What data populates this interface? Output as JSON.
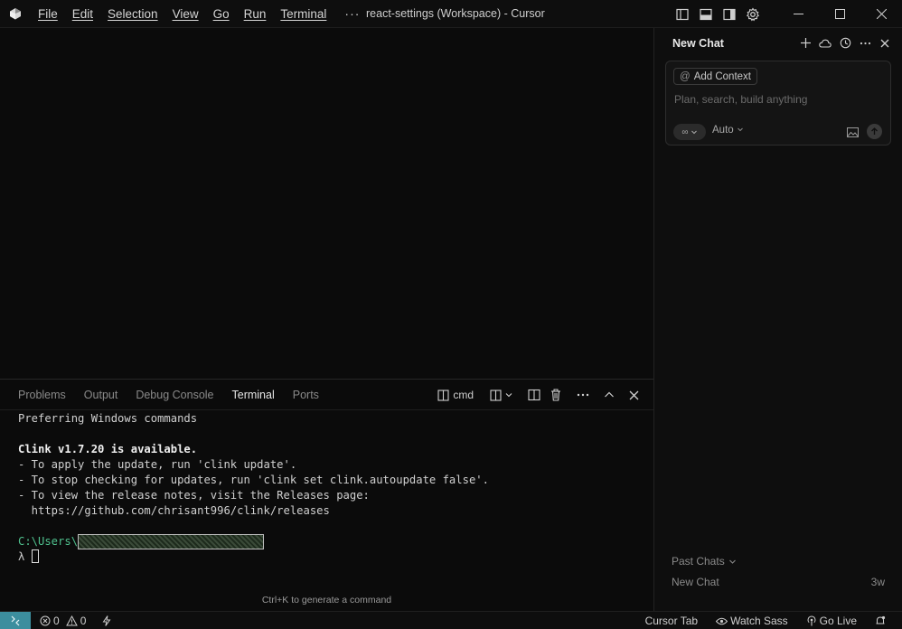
{
  "titlebar": {
    "menu": [
      "File",
      "Edit",
      "Selection",
      "View",
      "Go",
      "Run",
      "Terminal"
    ],
    "more": "···",
    "window_title": "react-settings (Workspace) - Cursor"
  },
  "panel": {
    "tabs": [
      "Problems",
      "Output",
      "Debug Console",
      "Terminal",
      "Ports"
    ],
    "active_tab": "Terminal",
    "shell_label": "cmd"
  },
  "terminal": {
    "line1": "Preferring Windows commands",
    "line2": "Clink v1.7.20 is available.",
    "line3": "- To apply the update, run 'clink update'.",
    "line4": "- To stop checking for updates, run 'clink set clink.autoupdate false'.",
    "line5": "- To view the release notes, visit the Releases page:",
    "line6": "  https://github.com/chrisant996/clink/releases",
    "prompt_path": "C:\\Users\\",
    "prompt_symbol": "λ ",
    "hint": "Ctrl+K to generate a command"
  },
  "chat": {
    "title": "New Chat",
    "add_context": "Add Context",
    "placeholder": "Plan, search, build anything",
    "model": "Auto",
    "past_chats_label": "Past Chats",
    "past_chats": [
      {
        "title": "New Chat",
        "age": "3w"
      }
    ]
  },
  "statusbar": {
    "errors": "0",
    "warnings": "0",
    "cursor_tab": "Cursor Tab",
    "watch_sass": "Watch Sass",
    "go_live": "Go Live"
  },
  "colors": {
    "remote_indicator": "#3c8e9e",
    "prompt_green": "#4fc08d",
    "background": "#0b0b0b"
  }
}
